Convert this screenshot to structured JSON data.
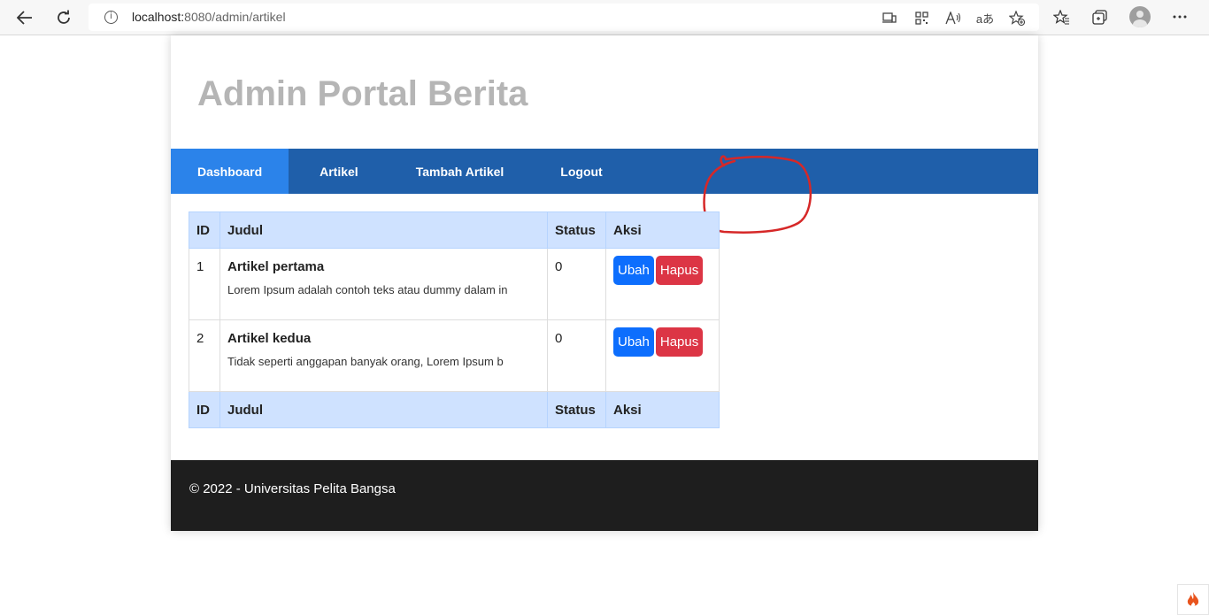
{
  "browser": {
    "url_host": "localhost:",
    "url_path": "8080/admin/artikel",
    "back_icon": "back-arrow-icon",
    "reload_icon": "reload-icon",
    "aa_label": "aあ"
  },
  "site": {
    "title": "Admin Portal Berita"
  },
  "nav": {
    "items": [
      {
        "label": "Dashboard",
        "active": true
      },
      {
        "label": "Artikel",
        "active": false
      },
      {
        "label": "Tambah Artikel",
        "active": false
      },
      {
        "label": "Logout",
        "active": false
      }
    ]
  },
  "table": {
    "headers": [
      "ID",
      "Judul",
      "Status",
      "Aksi"
    ],
    "rows": [
      {
        "id": "1",
        "title": "Artikel pertama",
        "desc": "Lorem Ipsum adalah contoh teks atau dummy dalam in",
        "status": "0",
        "edit_label": "Ubah",
        "delete_label": "Hapus"
      },
      {
        "id": "2",
        "title": "Artikel kedua",
        "desc": "Tidak seperti anggapan banyak orang, Lorem Ipsum b",
        "status": "0",
        "edit_label": "Ubah",
        "delete_label": "Hapus"
      }
    ],
    "footer_headers": [
      "ID",
      "Judul",
      "Status",
      "Aksi"
    ]
  },
  "footer": {
    "text": "© 2022 - Universitas Pelita Bangsa"
  },
  "colors": {
    "nav_bg": "#1f5faa",
    "nav_active": "#2b83ea",
    "table_head": "#cfe2ff",
    "btn_ubah": "#0d6efd",
    "btn_hapus": "#dc3545",
    "footer_bg": "#1e1e1e",
    "annotation": "#d62828"
  }
}
